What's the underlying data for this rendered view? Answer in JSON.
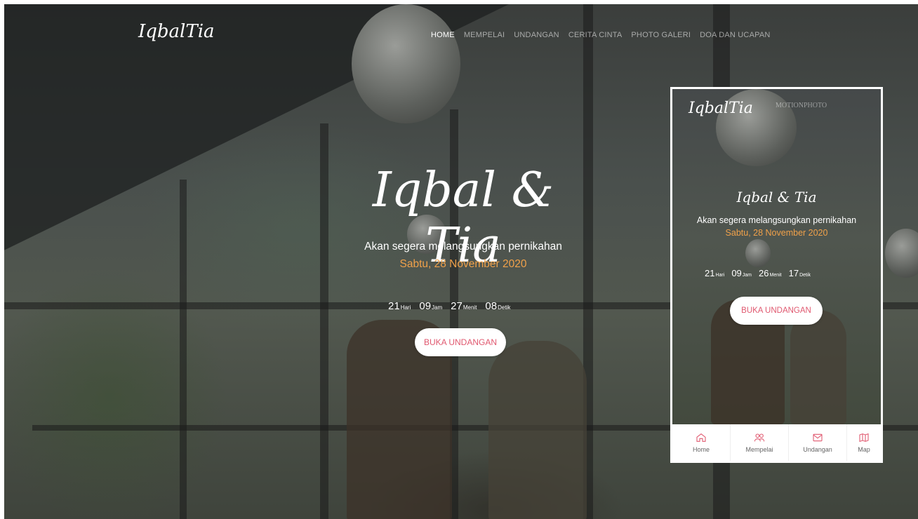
{
  "brand": "IqbalTia",
  "nav": {
    "items": [
      "HOME",
      "MEMPELAI",
      "UNDANGAN",
      "CERITA CINTA",
      "PHOTO GALERI",
      "DOA DAN UCAPAN"
    ]
  },
  "hero": {
    "couple": "Iqbal & Tia",
    "tagline": "Akan segera melangsungkan pernikahan",
    "date": "Sabtu, 28 November 2020",
    "countdown": [
      {
        "n": "21",
        "u": "Hari"
      },
      {
        "n": "09",
        "u": "Jam"
      },
      {
        "n": "27",
        "u": "Menit"
      },
      {
        "n": "08",
        "u": "Detik"
      }
    ],
    "button": "BUKA UNDANGAN"
  },
  "phone": {
    "brand": "IqbalTia",
    "watermark": "MOTIONPHOTO",
    "couple": "Iqbal & Tia",
    "tagline": "Akan segera melangsungkan pernikahan",
    "date": "Sabtu, 28 November 2020",
    "countdown": [
      {
        "n": "21",
        "u": "Hari"
      },
      {
        "n": "09",
        "u": "Jam"
      },
      {
        "n": "26",
        "u": "Menit"
      },
      {
        "n": "17",
        "u": "Detik"
      }
    ],
    "button": "BUKA UNDANGAN",
    "tabs": [
      {
        "label": "Home",
        "icon": "home-icon"
      },
      {
        "label": "Mempelai",
        "icon": "users-icon"
      },
      {
        "label": "Undangan",
        "icon": "mail-icon"
      },
      {
        "label": "Map",
        "icon": "map-icon"
      }
    ]
  },
  "colors": {
    "accent": "#f0a14a",
    "button_text": "#e0586f"
  }
}
